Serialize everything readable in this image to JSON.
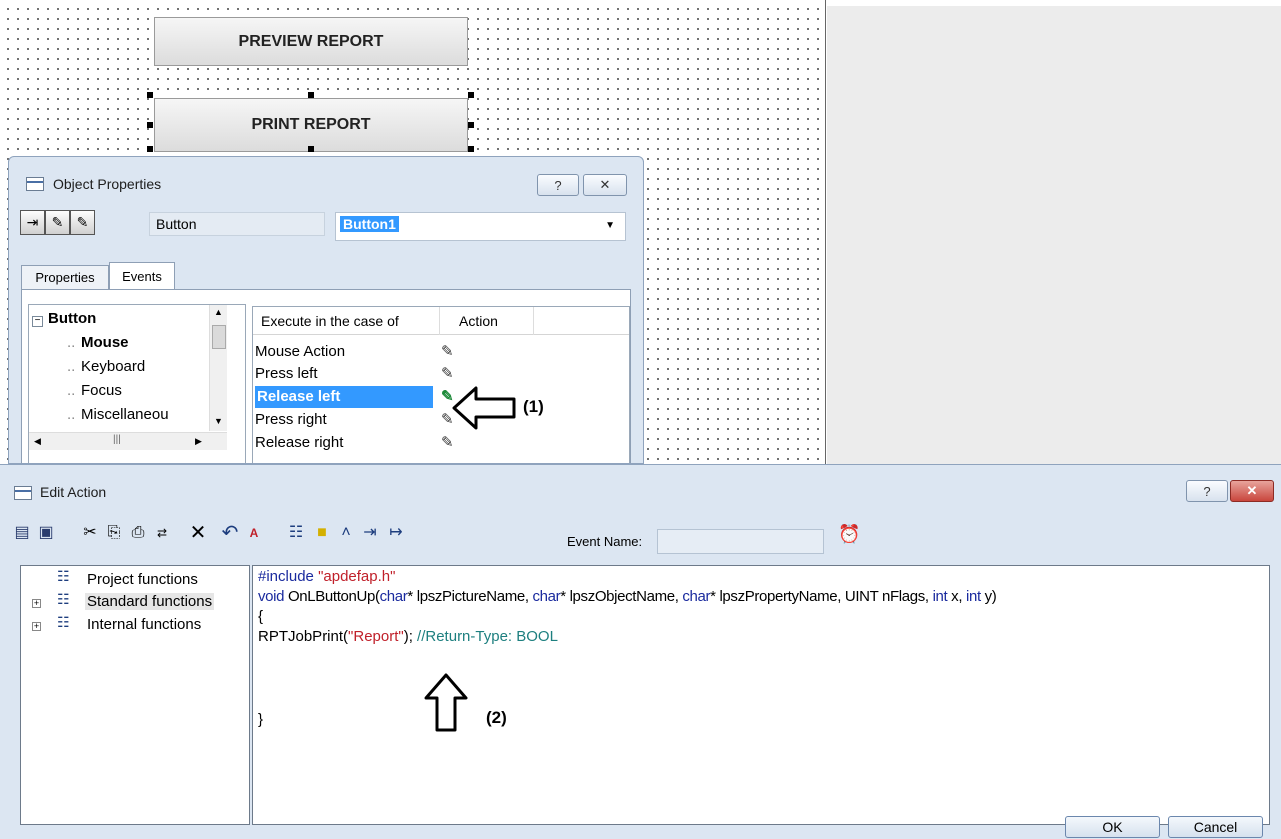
{
  "canvas": {
    "preview_button": "PREVIEW REPORT",
    "print_button": "PRINT REPORT"
  },
  "object_properties": {
    "title": "Object Properties",
    "help_button": "?",
    "close_icon": "close-icon",
    "object_type": "Button",
    "object_name": "Button1",
    "tabs": [
      "Properties",
      "Events"
    ],
    "tree": {
      "root": "Button",
      "children": [
        "Mouse",
        "Keyboard",
        "Focus",
        "Miscellaneou"
      ]
    },
    "events_table": {
      "headers": [
        "Execute in the case of",
        "Action"
      ],
      "rows": [
        "Mouse Action",
        "Press left",
        "Release left",
        "Press right",
        "Release right"
      ],
      "selected": "Release left"
    },
    "annotation": "(1)"
  },
  "edit_action": {
    "title": "Edit Action",
    "help_button": "?",
    "event_name_label": "Event Name:",
    "event_name_value": "",
    "function_tree": [
      "Project functions",
      "Standard functions",
      "Internal functions"
    ],
    "code": {
      "line1_directive": "#include",
      "line1_string": "\"apdefap.h\"",
      "line2_void": "void",
      "line2_a": " OnLButtonUp(",
      "line2_char1": "char",
      "line2_b": "* lpszPictureName, ",
      "line2_char2": "char",
      "line2_c": "* lpszObjectName, ",
      "line2_char3": "char",
      "line2_d": "* lpszPropertyName, UINT nFlags, ",
      "line2_int1": "int",
      "line2_e": " x, ",
      "line2_int2": "int",
      "line2_f": " y)",
      "line3": "{",
      "line4_a": "RPTJobPrint(",
      "line4_string": "\"Report\"",
      "line4_b": "); ",
      "line4_comment": "//Return-Type: BOOL",
      "line5": "}"
    },
    "annotation": "(2)",
    "ok_button": "OK",
    "cancel_button": "Cancel"
  },
  "colors": {
    "window_bg": "#dce6f2",
    "selection": "#3399ff",
    "close_red": "#c9463d",
    "keyword_blue": "#1a2a9e",
    "string_red": "#c0202a",
    "comment_teal": "#1d7f7f"
  }
}
